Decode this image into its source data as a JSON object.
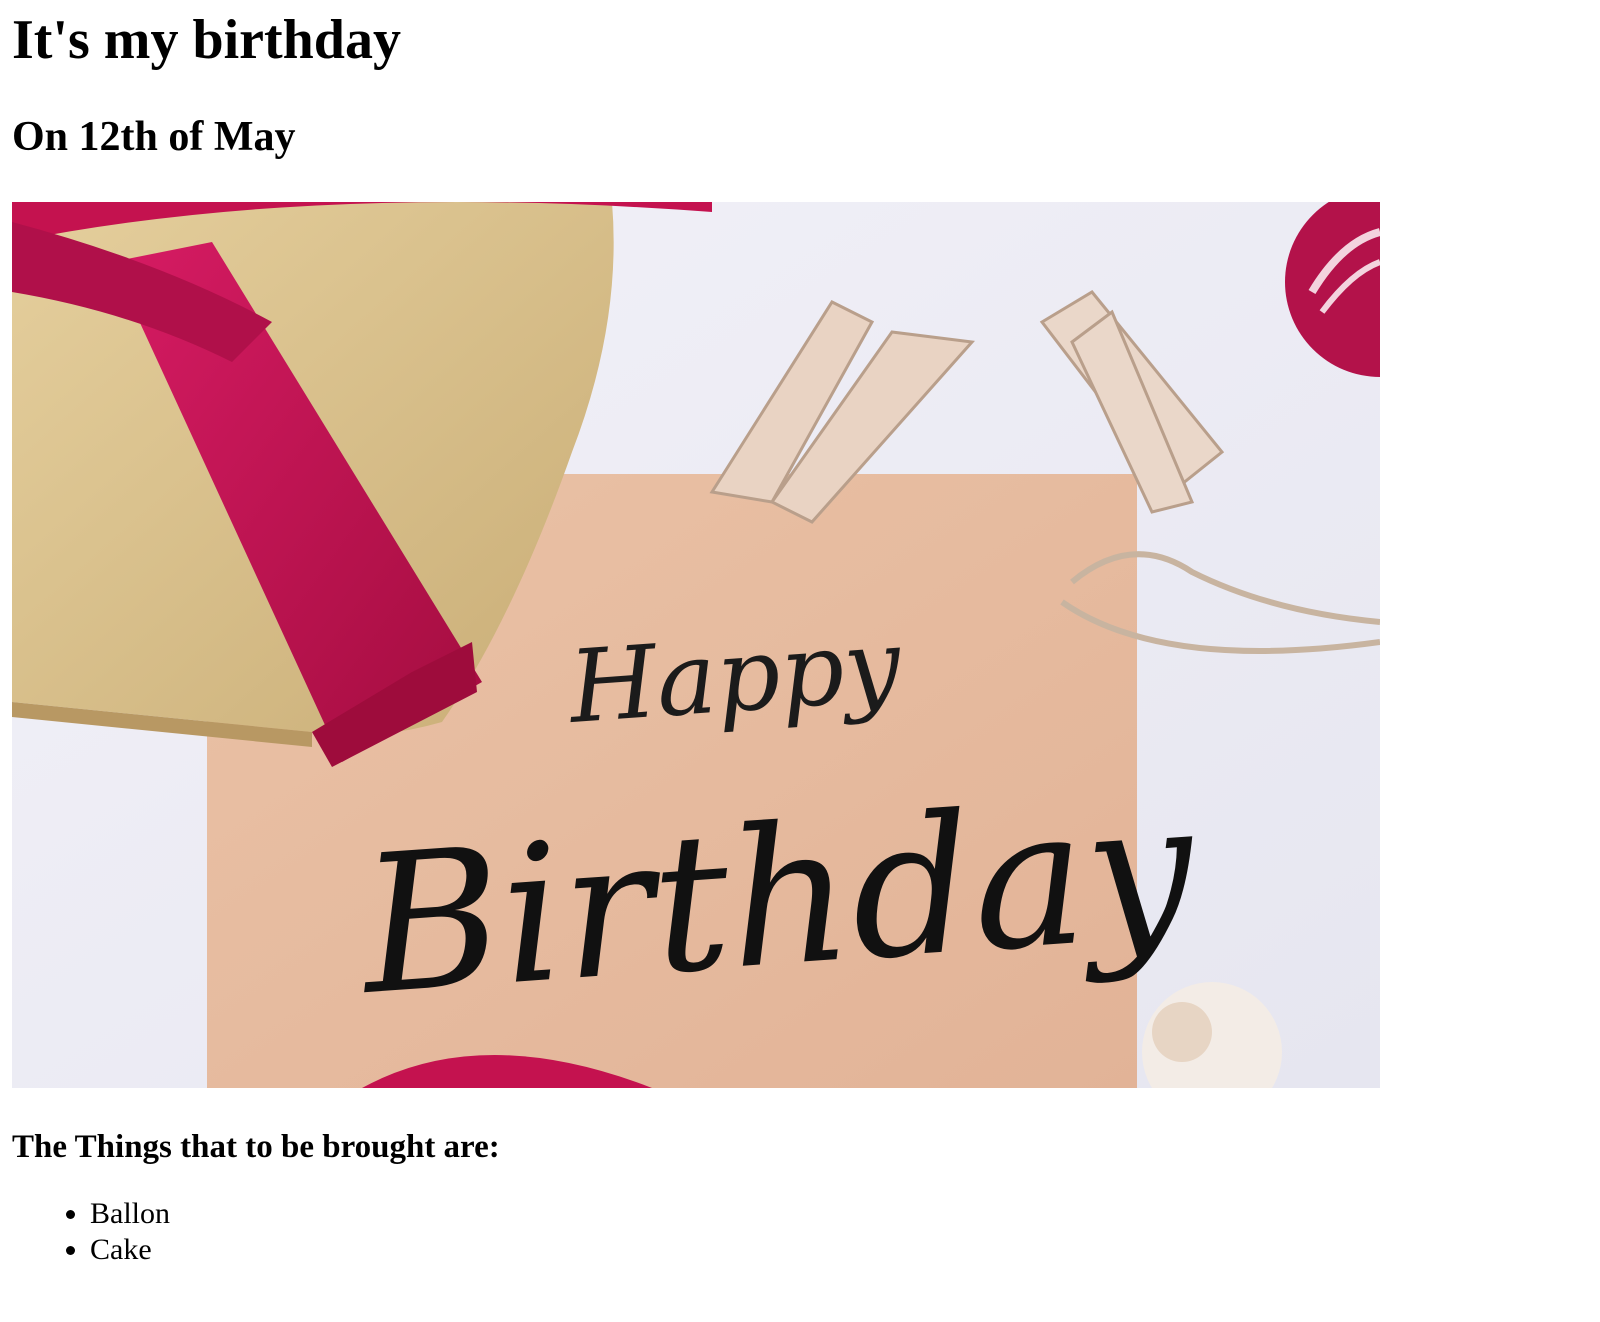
{
  "page": {
    "title": "It's my birthday",
    "subtitle": "On 12th of May",
    "image": {
      "script_line_1": "Happy",
      "script_line_2": "Birthday"
    },
    "list_heading": "The Things that to be brought are:",
    "items": [
      "Ballon",
      "Cake"
    ]
  },
  "colors": {
    "ribbon": "#c4124f",
    "gift_box": "#d9c08e",
    "card": "#e9bfa3",
    "background": "#eeeef6"
  }
}
